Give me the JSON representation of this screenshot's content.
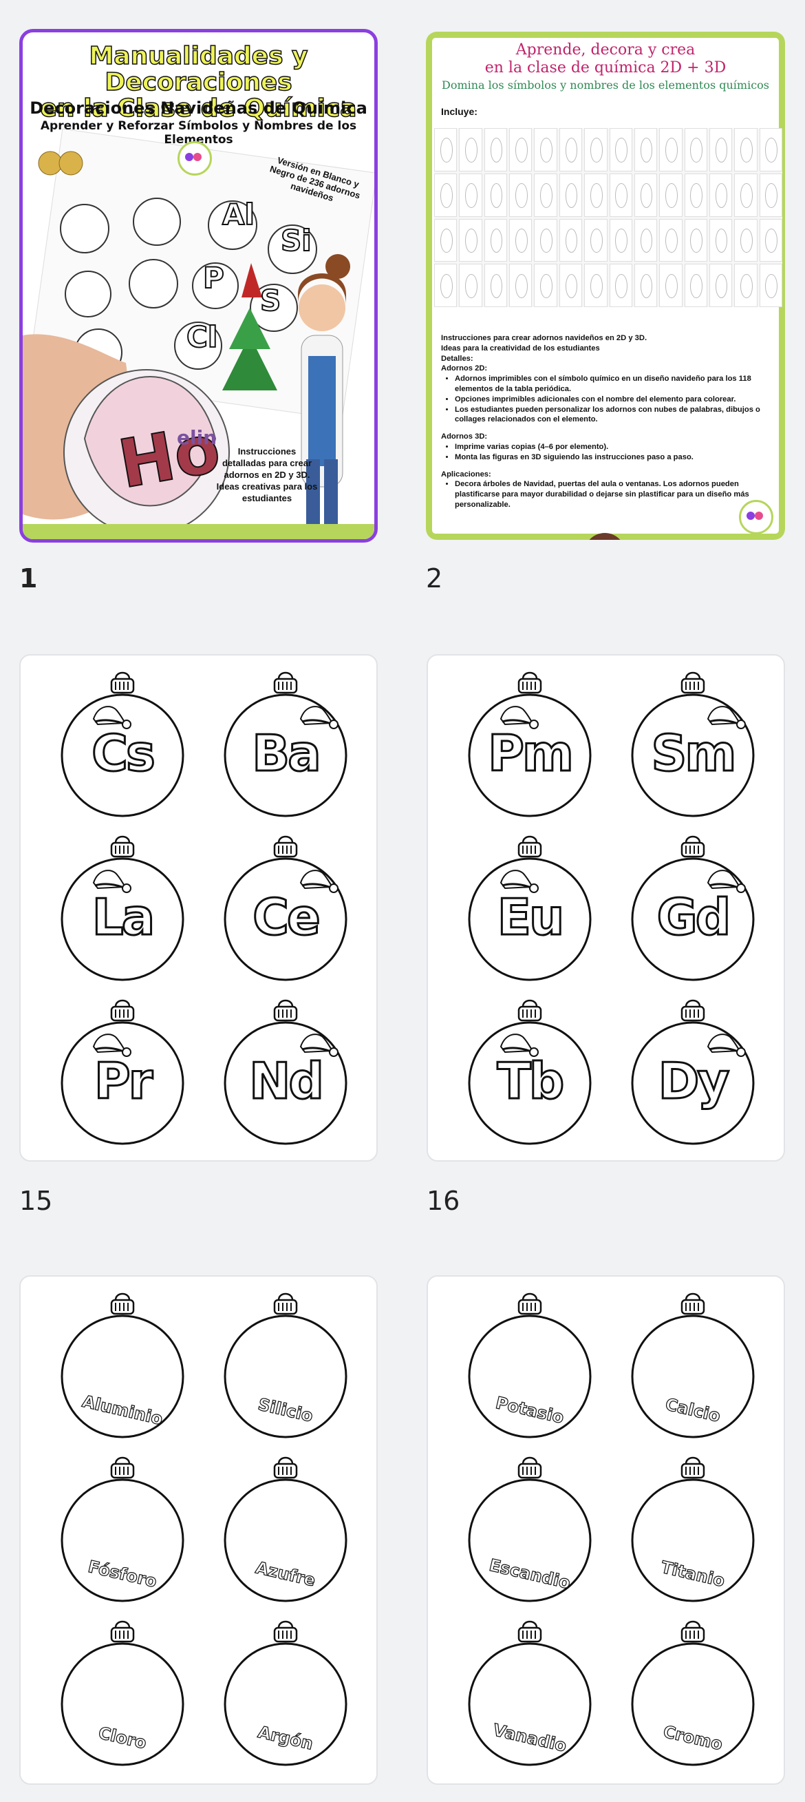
{
  "pages": [
    {
      "number": "1",
      "selected": true,
      "cover": {
        "title_line1": "Manualidades y Decoraciones",
        "title_line2": "en la Clase de Química",
        "subtitle": "Decoraciones Navideñas de Química",
        "tagline": "Aprender y Reforzar Símbolos y Nombres de los Elementos",
        "version_note": "Versión en Blanco y Negro de 236 adornos navideños",
        "instructions_note": "Instrucciones detalladas para crear adornos en 2D y 3D. Ideas creativas para los estudiantes",
        "sample_symbols": [
          "Al",
          "Si",
          "P",
          "S",
          "Cl"
        ],
        "photo_symbol": "Ho",
        "photo_text": "elin"
      }
    },
    {
      "number": "2",
      "selected": false,
      "overview": {
        "title_line1": "Aprende, decora y crea",
        "title_line2": "en la clase de química 2D + 3D",
        "subtitle": "Domina los símbolos y nombres de los elementos químicos",
        "includes_label": "Incluye:",
        "lines": [
          "Instrucciones para crear adornos navideños en 2D y 3D.",
          "Ideas para la creatividad de los estudiantes",
          "Detalles:",
          "Adornos 2D:"
        ],
        "bullets_2d": [
          "Adornos imprimibles con el símbolo químico en un diseño navideño para los 118 elementos de la tabla periódica.",
          "Opciones imprimibles adicionales con el nombre del elemento para colorear.",
          "Los estudiantes pueden personalizar los adornos con nubes de palabras, dibujos o collages relacionados con el elemento."
        ],
        "label_3d": "Adornos 3D:",
        "bullets_3d": [
          "Imprime varias copias (4–6 por elemento).",
          "Monta las figuras en 3D siguiendo las instrucciones paso a paso."
        ],
        "applications_label": "Aplicaciones:",
        "bullets_app": [
          "Decora árboles de Navidad, puertas del aula o ventanas. Los adornos pueden plastificarse para mayor durabilidad o dejarse sin plastificar para un diseño más personalizable."
        ]
      }
    },
    {
      "number": "15",
      "selected": false,
      "ornaments": [
        "Cs",
        "Ba",
        "La",
        "Ce",
        "Pr",
        "Nd"
      ]
    },
    {
      "number": "16",
      "selected": false,
      "ornaments": [
        "Pm",
        "Sm",
        "Eu",
        "Gd",
        "Tb",
        "Dy"
      ]
    },
    {
      "number": "",
      "selected": false,
      "names": [
        "Aluminio",
        "Silicio",
        "Fósforo",
        "Azufre",
        "Cloro",
        "Argón"
      ]
    },
    {
      "number": "",
      "selected": false,
      "names": [
        "Potasio",
        "Calcio",
        "Escandio",
        "Titanio",
        "Vanadio",
        "Cromo"
      ]
    }
  ],
  "colors": {
    "selection": "#8b3fe0",
    "accent_green": "#b6d65b",
    "title_yellow": "#eef35a",
    "magenta": "#c0246b"
  }
}
